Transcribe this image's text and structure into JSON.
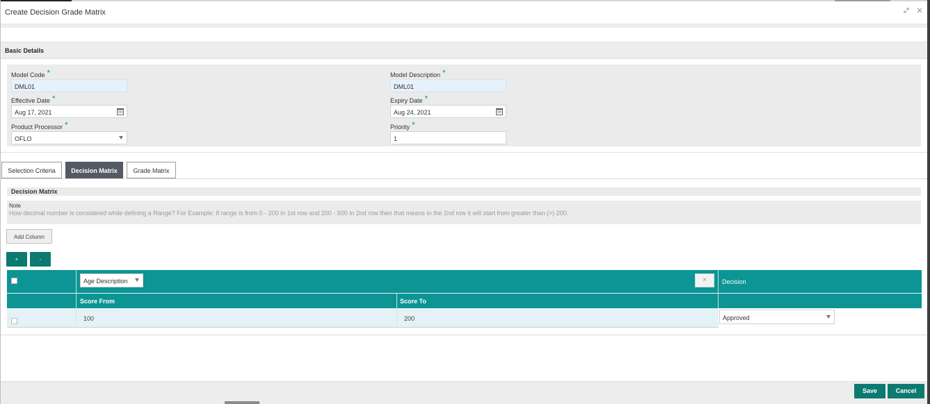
{
  "window": {
    "title": "Create Decision Grade Matrix",
    "minimize_icon": "collapse-arrows-icon",
    "close_icon": "close-icon"
  },
  "basic_details": {
    "section_title": "Basic Details",
    "required_marker": "*",
    "model_code": {
      "label": "Model Code",
      "value": "DML01"
    },
    "model_description": {
      "label": "Model Description",
      "value": "DML01"
    },
    "effective_date": {
      "label": "Effective Date",
      "value": "Aug 17, 2021"
    },
    "expiry_date": {
      "label": "Expiry Date",
      "value": "Aug 24, 2021"
    },
    "product_processor": {
      "label": "Product Processor",
      "value": "OFLO"
    },
    "priority": {
      "label": "Priority",
      "value": "1"
    }
  },
  "tabs": [
    {
      "label": "Selection Criteria",
      "active": false
    },
    {
      "label": "Decision Matrix",
      "active": true
    },
    {
      "label": "Grade Matrix",
      "active": false
    }
  ],
  "decision_matrix": {
    "section_title": "Decision Matrix",
    "note_label": "Note",
    "note_text": "How decimal number is considered while defining a Range? For Example: If range is from 0 - 200 in 1st row and 200 - 500 in 2nd row then that means in the 2nd row it will start from greater than (>) 200.",
    "add_column_label": "Add Column",
    "add_row_label": "+",
    "remove_row_label": "-",
    "column_select": "Age Description",
    "remove_column_icon": "×",
    "decision_header": "Decision",
    "score_from_header": "Score From",
    "score_to_header": "Score To",
    "rows": [
      {
        "score_from": "100",
        "score_to": "200",
        "decision": "Approved"
      }
    ]
  },
  "footer": {
    "save_label": "Save",
    "cancel_label": "Cancel"
  },
  "colors": {
    "accent_teal": "#0d9494",
    "button_teal": "#0d7a72",
    "active_tab": "#545a64"
  }
}
